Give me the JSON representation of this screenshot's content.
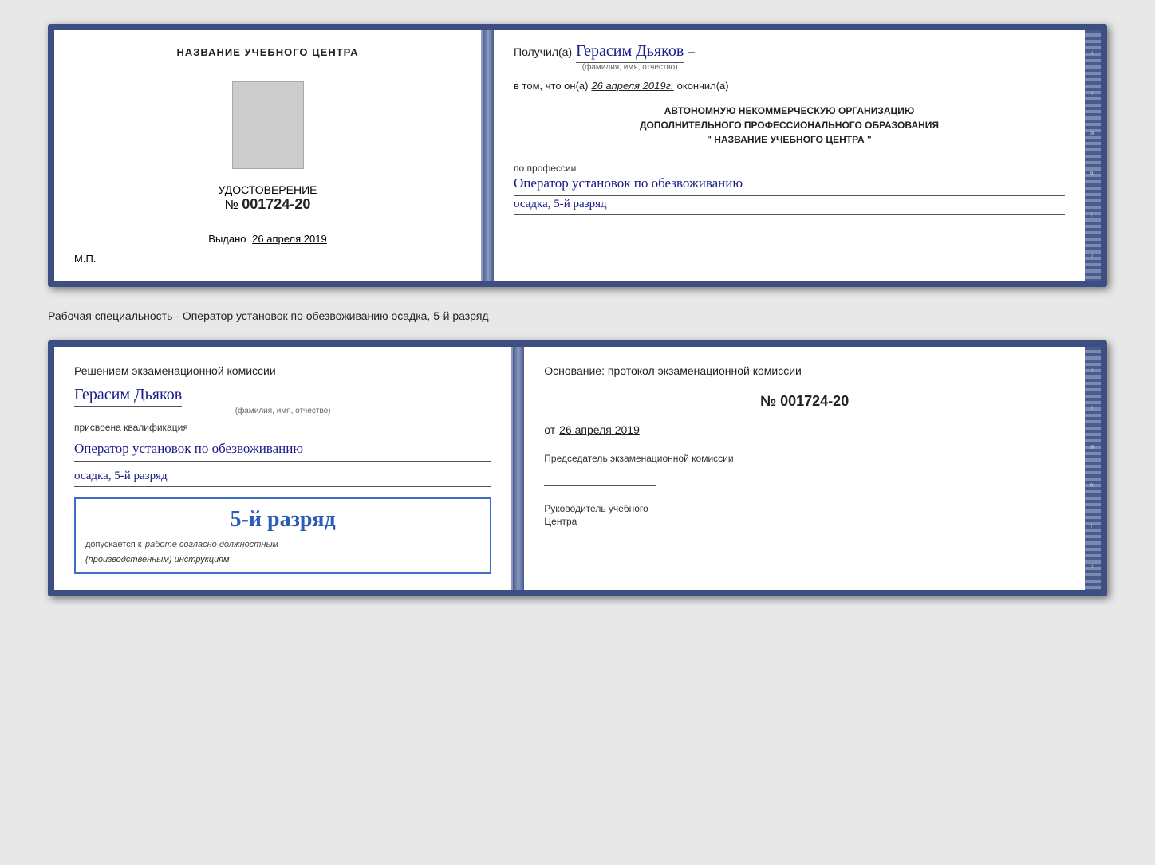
{
  "top_cert": {
    "left": {
      "title": "НАЗВАНИЕ УЧЕБНОГО ЦЕНТРА",
      "cert_label": "УДОСТОВЕРЕНИЕ",
      "cert_number_prefix": "№",
      "cert_number": "001724-20",
      "issued_label": "Выдано",
      "issued_date": "26 апреля 2019",
      "mp_label": "М.П."
    },
    "right": {
      "received_prefix": "Получил(а)",
      "recipient_name": "Герасим Дьяков",
      "recipient_label": "(фамилия, имя, отчество)",
      "in_that_prefix": "в том, что он(а)",
      "in_that_date": "26 апреля 2019г.",
      "finished_label": "окончил(а)",
      "org_line1": "АВТОНОМНУЮ НЕКОММЕРЧЕСКУЮ ОРГАНИЗАЦИЮ",
      "org_line2": "ДОПОЛНИТЕЛЬНОГО ПРОФЕССИОНАЛЬНОГО ОБРАЗОВАНИЯ",
      "org_line3": "\"  НАЗВАНИЕ УЧЕБНОГО ЦЕНТРА  \"",
      "profession_label": "по профессии",
      "profession_value": "Оператор установок по обезвоживанию",
      "profession_value2": "осадка, 5-й разряд"
    }
  },
  "specialty_label": "Рабочая специальность - Оператор установок по обезвоживанию осадка, 5-й разряд",
  "bottom_cert": {
    "left": {
      "commission_text": "Решением экзаменационной комиссии",
      "person_name": "Герасим Дьяков",
      "person_label": "(фамилия, имя, отчество)",
      "assigned_label": "присвоена квалификация",
      "qualification1": "Оператор установок по обезвоживанию",
      "qualification2": "осадка, 5-й разряд",
      "stamp_large": "5-й разряд",
      "stamp_prefix": "допускается к",
      "stamp_underline": "работе согласно должностным",
      "stamp_italic": "(производственным) инструкциям"
    },
    "right": {
      "basis_text": "Основание: протокол экзаменационной комиссии",
      "protocol_prefix": "№",
      "protocol_number": "001724-20",
      "date_prefix": "от",
      "date_value": "26 апреля 2019",
      "chairman_title": "Председатель экзаменационной комиссии",
      "director_title_line1": "Руководитель учебного",
      "director_title_line2": "Центра"
    }
  },
  "side_chars": [
    "и",
    "а",
    "←",
    "–",
    "–",
    "–"
  ],
  "side_chars2": [
    "и",
    "а",
    "←",
    "–",
    "–",
    "–"
  ]
}
